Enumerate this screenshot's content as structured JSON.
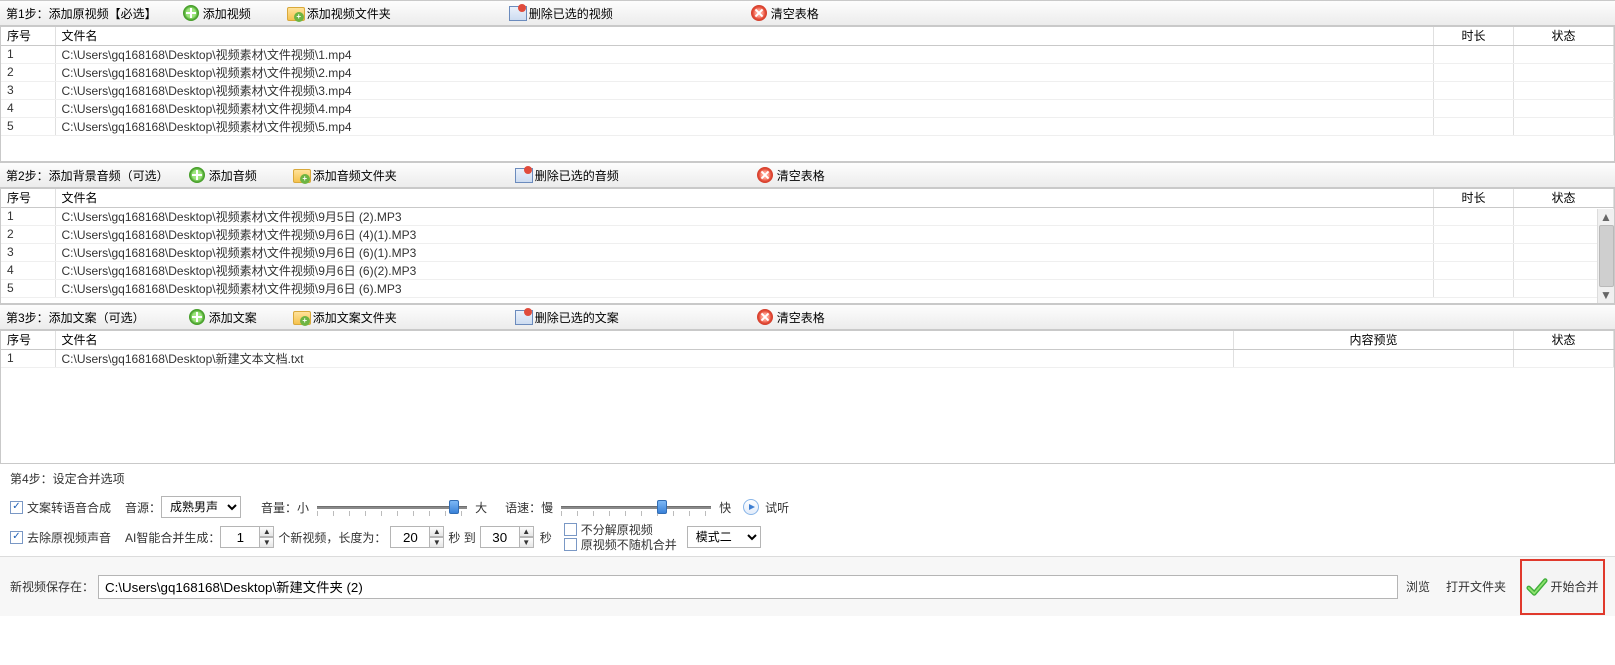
{
  "sections": {
    "s1": {
      "step": "第1步：添加原视频【必选】",
      "btn_add": "添加视频",
      "btn_add_folder": "添加视频文件夹",
      "btn_del": "删除已选的视频",
      "btn_clear": "清空表格",
      "cols": {
        "seq": "序号",
        "name": "文件名",
        "dur": "时长",
        "stat": "状态"
      },
      "rows": [
        {
          "seq": "1",
          "name": "C:\\Users\\gq168168\\Desktop\\视频素材\\文件视频\\1.mp4"
        },
        {
          "seq": "2",
          "name": "C:\\Users\\gq168168\\Desktop\\视频素材\\文件视频\\2.mp4"
        },
        {
          "seq": "3",
          "name": "C:\\Users\\gq168168\\Desktop\\视频素材\\文件视频\\3.mp4"
        },
        {
          "seq": "4",
          "name": "C:\\Users\\gq168168\\Desktop\\视频素材\\文件视频\\4.mp4"
        },
        {
          "seq": "5",
          "name": "C:\\Users\\gq168168\\Desktop\\视频素材\\文件视频\\5.mp4"
        }
      ]
    },
    "s2": {
      "step": "第2步：添加背景音频（可选）",
      "btn_add": "添加音频",
      "btn_add_folder": "添加音频文件夹",
      "btn_del": "删除已选的音频",
      "btn_clear": "清空表格",
      "cols": {
        "seq": "序号",
        "name": "文件名",
        "dur": "时长",
        "stat": "状态"
      },
      "rows": [
        {
          "seq": "1",
          "name": "C:\\Users\\gq168168\\Desktop\\视频素材\\文件视频\\9月5日 (2).MP3"
        },
        {
          "seq": "2",
          "name": "C:\\Users\\gq168168\\Desktop\\视频素材\\文件视频\\9月6日 (4)(1).MP3"
        },
        {
          "seq": "3",
          "name": "C:\\Users\\gq168168\\Desktop\\视频素材\\文件视频\\9月6日 (6)(1).MP3"
        },
        {
          "seq": "4",
          "name": "C:\\Users\\gq168168\\Desktop\\视频素材\\文件视频\\9月6日 (6)(2).MP3"
        },
        {
          "seq": "5",
          "name": "C:\\Users\\gq168168\\Desktop\\视频素材\\文件视频\\9月6日 (6).MP3"
        }
      ]
    },
    "s3": {
      "step": "第3步：添加文案（可选）",
      "btn_add": "添加文案",
      "btn_add_folder": "添加文案文件夹",
      "btn_del": "删除已选的文案",
      "btn_clear": "清空表格",
      "cols": {
        "seq": "序号",
        "name": "文件名",
        "prev": "内容预览",
        "stat": "状态"
      },
      "rows": [
        {
          "seq": "1",
          "name": "C:\\Users\\gq168168\\Desktop\\新建文本文档.txt"
        }
      ]
    }
  },
  "step4": {
    "title": "第4步：设定合并选项",
    "tts_label": "文案转语音合成",
    "voice_label": "音源：",
    "voice_value": "成熟男声",
    "volume_label": "音量：",
    "volume_small": "小",
    "volume_big": "大",
    "speed_label": "语速：",
    "speed_slow": "慢",
    "speed_fast": "快",
    "preview": "试听",
    "strip_audio": "去除原视频声音",
    "ai_label": "AI智能合并生成：",
    "ai_count": "1",
    "ai_unit": "个新视频，长度为：",
    "sec_from": "20",
    "sec_mid": "秒 到",
    "sec_to": "30",
    "sec_label": "秒",
    "no_split": "不分解原视频",
    "no_shuffle": "原视频不随机合并",
    "mode": "模式二"
  },
  "savebar": {
    "label": "新视频保存在：",
    "path": "C:\\Users\\gq168168\\Desktop\\新建文件夹 (2)",
    "browse": "浏览",
    "open": "打开文件夹",
    "start": "开始合并"
  }
}
